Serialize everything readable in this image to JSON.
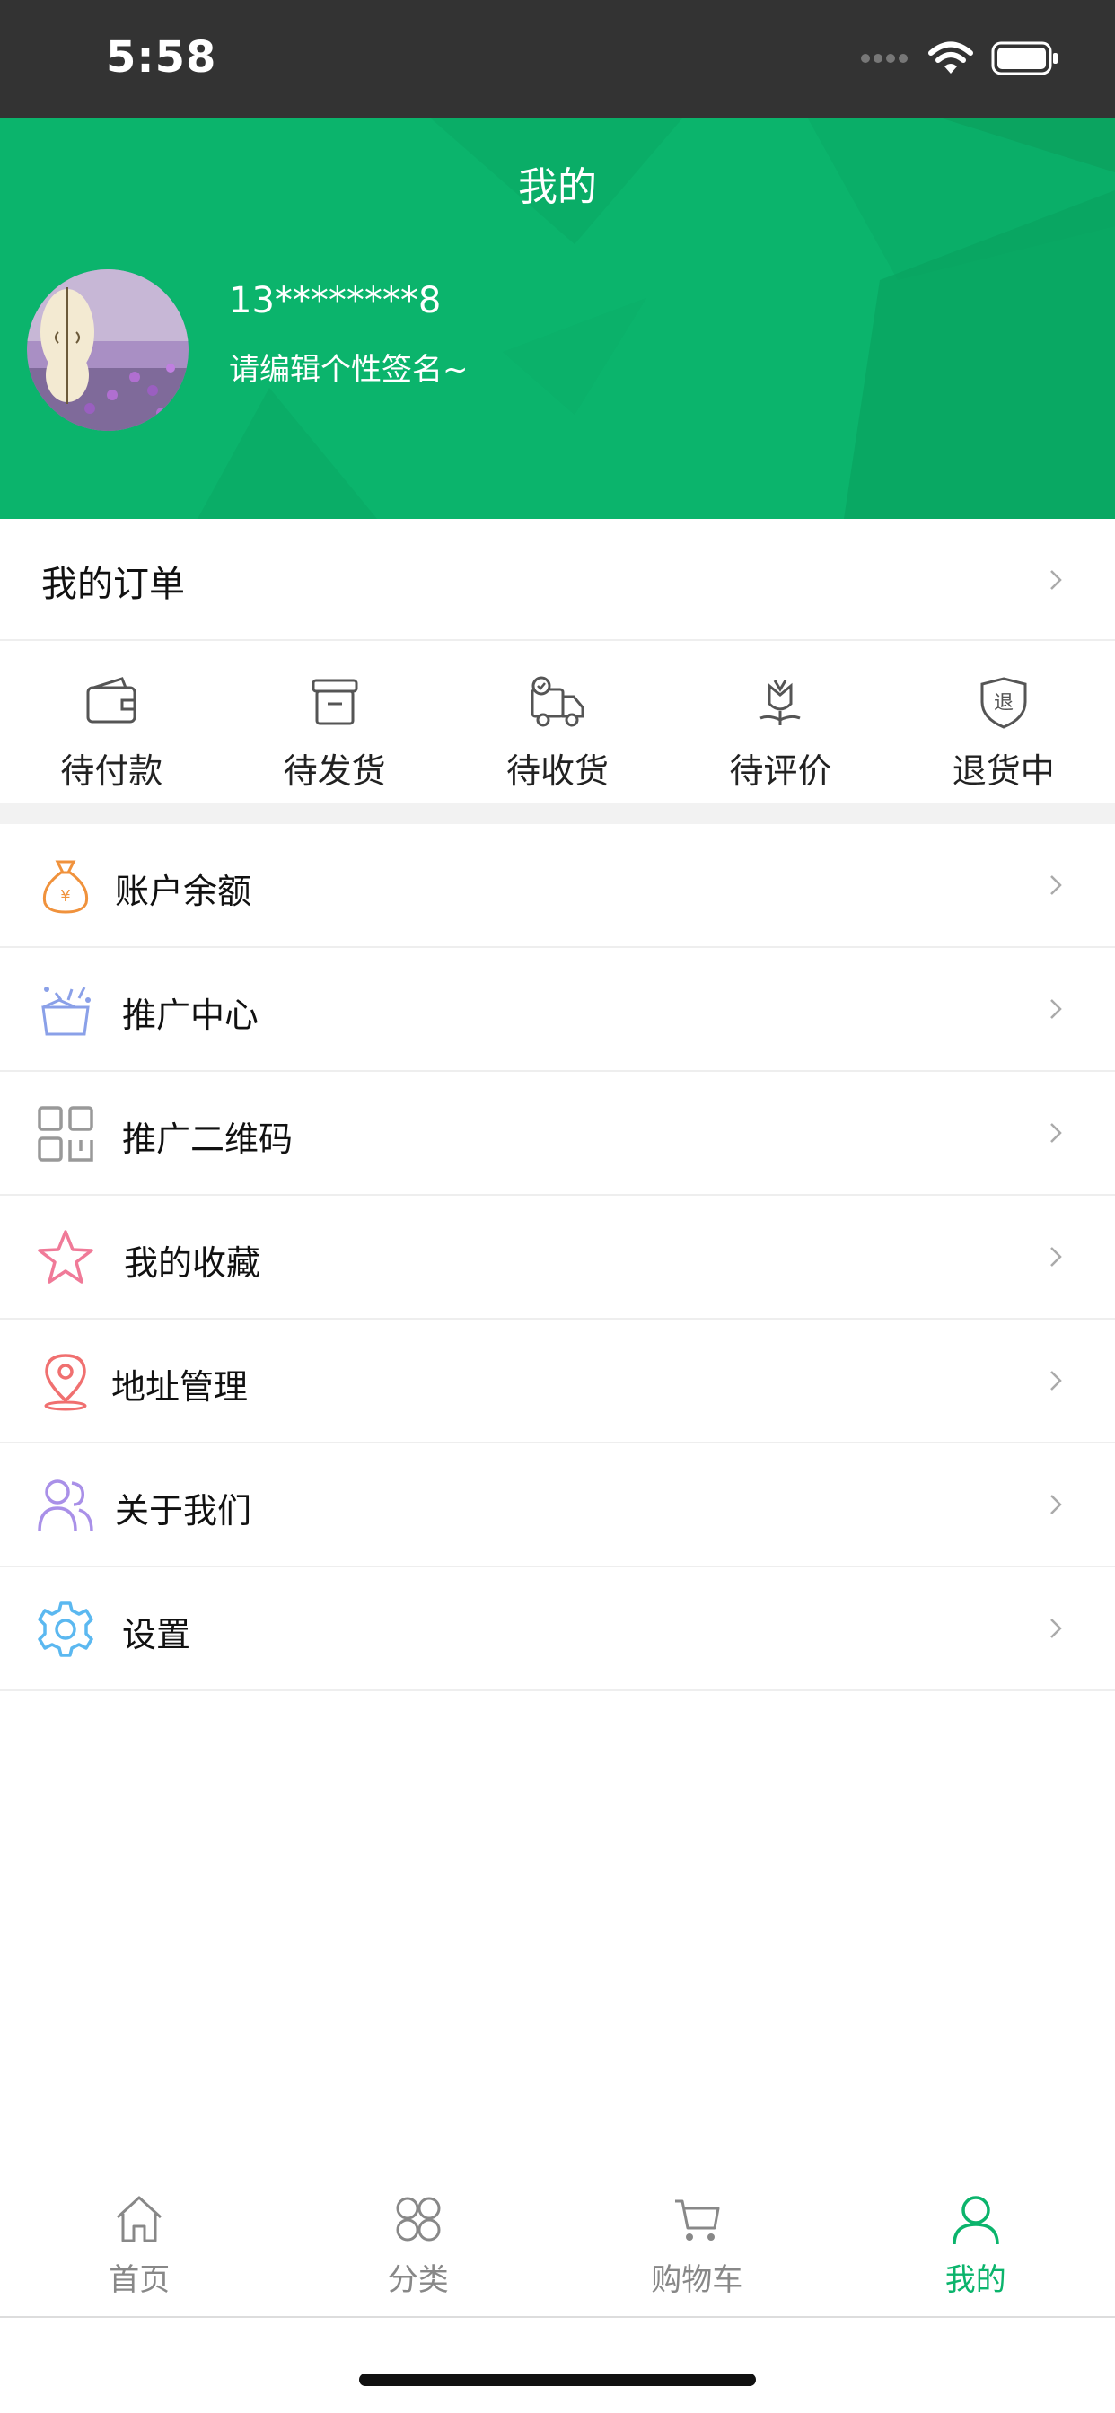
{
  "status_bar": {
    "time": "5:58"
  },
  "header": {
    "title": "我的",
    "phone": "13********8",
    "signature": "请编辑个性签名~"
  },
  "orders": {
    "title": "我的订单",
    "statuses": [
      {
        "label": "待付款",
        "icon": "wallet-icon"
      },
      {
        "label": "待发货",
        "icon": "box-icon"
      },
      {
        "label": "待收货",
        "icon": "truck-icon"
      },
      {
        "label": "待评价",
        "icon": "flower-icon"
      },
      {
        "label": "退货中",
        "icon": "return-shield-icon"
      }
    ]
  },
  "menu": [
    {
      "label": "账户余额",
      "icon": "money-bag-icon",
      "color": "#f0923c"
    },
    {
      "label": "推广中心",
      "icon": "gift-box-icon",
      "color": "#8aa0e8"
    },
    {
      "label": "推广二维码",
      "icon": "qrcode-icon",
      "color": "#999999"
    },
    {
      "label": "我的收藏",
      "icon": "star-icon",
      "color": "#f07a98"
    },
    {
      "label": "地址管理",
      "icon": "location-icon",
      "color": "#f07070"
    },
    {
      "label": "关于我们",
      "icon": "users-icon",
      "color": "#a990e8"
    },
    {
      "label": "设置",
      "icon": "gear-icon",
      "color": "#5bb8f0"
    }
  ],
  "tabbar": {
    "active_color": "#0bb46c",
    "tabs": [
      {
        "label": "首页",
        "icon": "home-icon"
      },
      {
        "label": "分类",
        "icon": "category-icon"
      },
      {
        "label": "购物车",
        "icon": "cart-icon"
      },
      {
        "label": "我的",
        "icon": "user-icon",
        "active": true
      }
    ]
  }
}
